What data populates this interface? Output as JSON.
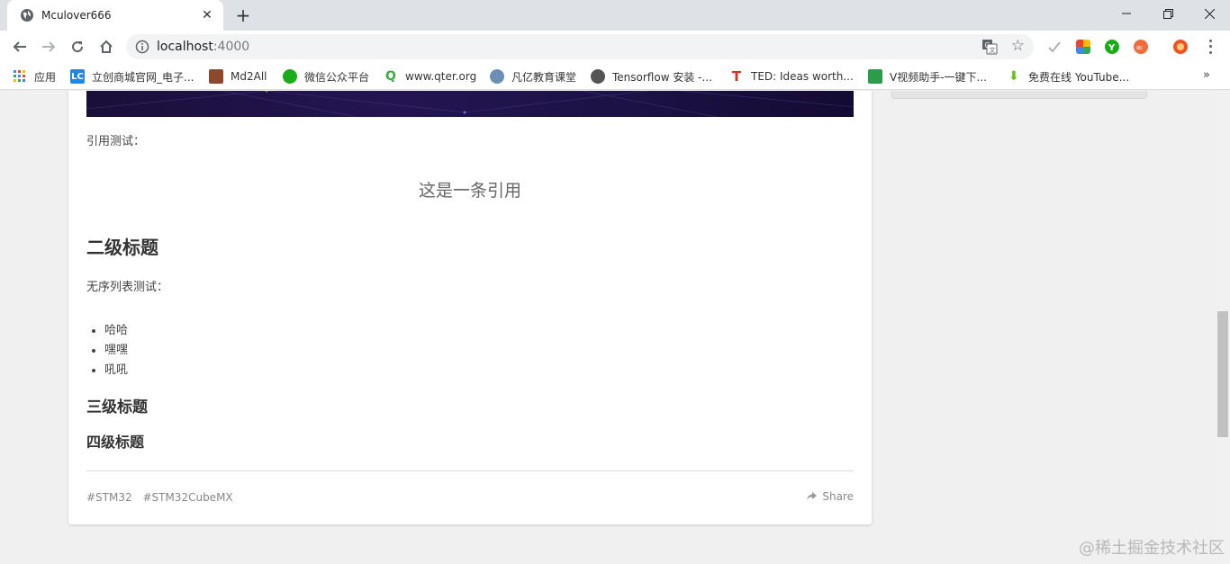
{
  "browser": {
    "tab_title": "Mculover666",
    "url_host": "localhost",
    "url_port": ":4000"
  },
  "bookmarks": [
    {
      "label": "应用",
      "icon": "apps-grid-icon",
      "color": "#4285f4"
    },
    {
      "label": "立创商城官网_电子...",
      "icon": "lc-icon",
      "color": "#1e88e5"
    },
    {
      "label": "Md2All",
      "icon": "md2all-icon",
      "color": "#8b4a2b"
    },
    {
      "label": "微信公众平台",
      "icon": "wechat-icon",
      "color": "#1aad19"
    },
    {
      "label": "www.qter.org",
      "icon": "qter-icon",
      "color": "#3cab3c"
    },
    {
      "label": "凡亿教育课堂",
      "icon": "user-circle-icon",
      "color": "#6b8fb3"
    },
    {
      "label": "Tensorflow 安装 -...",
      "icon": "globe-icon",
      "color": "#555555"
    },
    {
      "label": "TED: Ideas worth...",
      "icon": "ted-icon",
      "color": "#e62b1e"
    },
    {
      "label": "V视频助手-一键下...",
      "icon": "video-helper-icon",
      "color": "#2a9d4b"
    },
    {
      "label": "免费在线 YouTube...",
      "icon": "download-icon",
      "color": "#6cbd25"
    }
  ],
  "article": {
    "quote_intro": "引用测试：",
    "quote_text": "这是一条引用",
    "h2": "二级标题",
    "list_intro": "无序列表测试：",
    "list_items": [
      "哈哈",
      "嘿嘿",
      "吼吼"
    ],
    "h3": "三级标题",
    "h4": "四级标题",
    "tags": [
      "#STM32",
      "#STM32CubeMX"
    ],
    "share_label": "Share"
  },
  "watermark": "@稀土掘金技术社区"
}
